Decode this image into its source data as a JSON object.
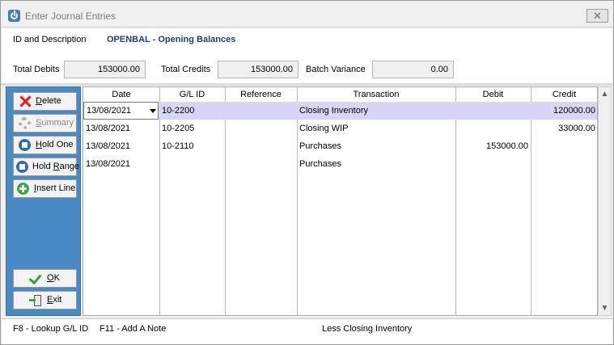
{
  "window": {
    "title": "Enter Journal Entries",
    "close_glyph": "✕",
    "icon": "power-icon"
  },
  "header": {
    "id_label": "ID and Description",
    "id_value": "OPENBAL - Opening Balances",
    "total_debits_label": "Total Debits",
    "total_debits_value": "153000.00",
    "total_credits_label": "Total Credits",
    "total_credits_value": "153000.00",
    "batch_variance_label": "Batch Variance",
    "batch_variance_value": "0.00"
  },
  "sidebar": {
    "delete": {
      "pre": "",
      "u": "D",
      "post": "elete",
      "icon": "red-x-icon"
    },
    "summary": {
      "pre": "",
      "u": "S",
      "post": "ummary",
      "icon": "gear-icon"
    },
    "hold_one": {
      "pre": "",
      "u": "H",
      "post": "old One",
      "icon": "hold-icon"
    },
    "hold_range": {
      "pre": "Hold ",
      "u": "R",
      "post": "ange",
      "icon": "hold-icon"
    },
    "insert_line": {
      "pre": "",
      "u": "I",
      "post": "nsert Line",
      "icon": "plus-icon"
    },
    "ok": {
      "pre": "",
      "u": "O",
      "post": "K",
      "icon": "check-icon"
    },
    "exit": {
      "pre": "",
      "u": "E",
      "post": "xit",
      "icon": "exit-icon"
    }
  },
  "grid": {
    "columns": [
      "Date",
      "G/L ID",
      "Reference",
      "Transaction",
      "Debit",
      "Credit"
    ],
    "rows": [
      {
        "date": "13/08/2021",
        "gl_id": "10-2200",
        "reference": "",
        "transaction": "Closing Inventory",
        "debit": "",
        "credit": "120000.00"
      },
      {
        "date": "13/08/2021",
        "gl_id": "10-2205",
        "reference": "",
        "transaction": "Closing WIP",
        "debit": "",
        "credit": "33000.00"
      },
      {
        "date": "13/08/2021",
        "gl_id": "10-2110",
        "reference": "",
        "transaction": "Purchases",
        "debit": "153000.00",
        "credit": ""
      },
      {
        "date": "13/08/2021",
        "gl_id": "",
        "reference": "",
        "transaction": "Purchases",
        "debit": "",
        "credit": ""
      }
    ]
  },
  "scrollbar": {
    "up_glyph": "▲",
    "down_glyph": "▼"
  },
  "status_bar": {
    "f8": "F8 - Lookup G/L ID",
    "f11": "F11 - Add A Note",
    "message": "Less Closing Inventory"
  }
}
